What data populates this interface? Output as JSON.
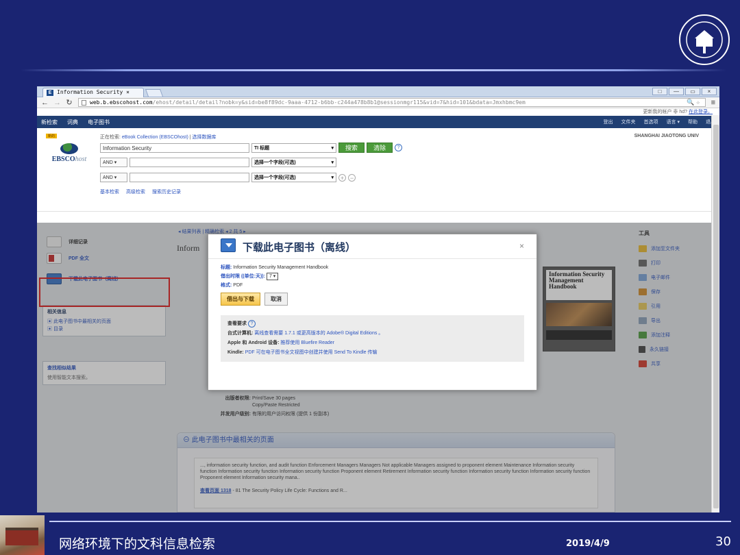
{
  "slide": {
    "footer_title": "网络环境下的文科信息检索",
    "footer_date": "2019/4/9",
    "page_number": "30"
  },
  "browser": {
    "tab_title": "Information Security ×",
    "url_host": "web.b.ebscohost.com",
    "url_path": "/ehost/detail/detail?nobk=y&sid=be8f89dc-9aaa-4712-b6bb-c244a478b8b1@sessionmgr115&vid=7&hid=101&bdata=Jmxhbmc9em",
    "win_buttons": [
      "□",
      "—",
      "▭",
      "×"
    ]
  },
  "ebsco": {
    "account_bar": "更新我的帐户  非 hd?",
    "account_login": "在此登录。",
    "topnav_left": [
      "新检索",
      "词典",
      "电子图书"
    ],
    "topnav_right": [
      "登出",
      "文件夹",
      "首选项",
      "语言 ▾",
      "帮助",
      "退出"
    ],
    "logo_text": "EBSCO",
    "logo_host": "host",
    "badge_new": "新的",
    "searching_prefix": "正在检索:",
    "searching_db": "eBook Collection (EBSCOhost)",
    "choose_db": "选择数据库",
    "query": "Information Security",
    "field1": "TI 标题",
    "field_other": "选择一个字段(可选)",
    "bool1": "AND",
    "bool2": "AND",
    "search_btn": "搜索",
    "clear_btn": "清除",
    "help": "?",
    "links": [
      "基本检索",
      "高级检索",
      "搜索历史记录"
    ],
    "org": "SHANGHAI JIAOTONG UNIV"
  },
  "left": {
    "items": [
      "详细记录",
      "PDF 全文",
      "下载此电子图书（离线）"
    ],
    "related_title": "相关信息",
    "related_items": [
      "此电子图书中最相关的页面",
      "目录"
    ],
    "similar_title": "查找相似结果",
    "similar_sub": "使用智能文本搜索。"
  },
  "main": {
    "result_nav": "◂ 结果列表 | 精确检索   ◂ 2 共 5 ▸",
    "title_partial": "Inform",
    "rights_label": "出版者权限:",
    "rights_value1": "Print/Save 30 pages",
    "rights_value2": "Copy/Paste Restricted",
    "users_label": "并发用户级别:",
    "users_value": "有限的用户访问权限 (提供 1 份副本)",
    "related_panel": "此电子图书中最相关的页面",
    "snippet": "..., information security function, and audit function Enforcement Managers Managers Not applicable Managers assigned to proponent element Maintenance Information security function Information security function Information security function Proponent element Retirement Information security function Information security function Information security function Proponent element Information security mana..",
    "view_page": "查看页面 1318",
    "view_page_rest": " - 81 The Security Policy Life Cycle: Functions and R...",
    "cover_title": "Information Security Management Handbook"
  },
  "tools": {
    "title": "工具",
    "items": [
      "添加至文件夹",
      "打印",
      "电子邮件",
      "保存",
      "引用",
      "导出",
      "添加注释",
      "永久链接",
      "共享"
    ]
  },
  "modal": {
    "title": "下载此电子图书（离线）",
    "close": "×",
    "title_label": "标题:",
    "title_value": "Information Security Management Handbook",
    "loan_label": "借出时限 ((单位:天)):",
    "loan_value": "7 ▾",
    "format_label": "格式:",
    "format_value": "PDF",
    "checkout_btn": "借出与下载",
    "cancel_btn": "取消",
    "req_title": "查看要求",
    "req1_label": "台式计算机:",
    "req1_value": "离线查看需要 1.7.1 或更高版本的 Adobe® Digital Editions 。",
    "req2_label": "Apple 和 Android 设备:",
    "req2_value": "推荐使用 Bluefire Reader",
    "req3_label": "Kindle:",
    "req3_value": "PDF 可在电子图书全文视图中创建并使用 Send To Kindle 传输"
  }
}
